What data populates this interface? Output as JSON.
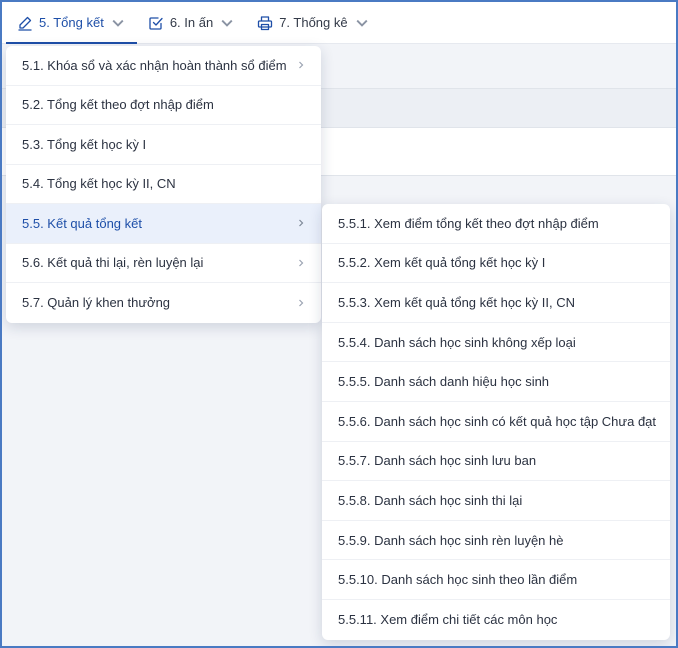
{
  "topnav": {
    "tabs": [
      {
        "label": "5. Tổng kết",
        "icon": "pencil-icon",
        "active": true
      },
      {
        "label": "6. In ấn",
        "icon": "checkbox-icon",
        "active": false
      },
      {
        "label": "7. Thống kê",
        "icon": "printer-icon",
        "active": false
      }
    ]
  },
  "menu": {
    "items": [
      {
        "label": "5.1. Khóa sổ và xác nhận hoàn thành sổ điểm",
        "has_submenu": true
      },
      {
        "label": "5.2. Tổng kết theo đợt nhập điểm",
        "has_submenu": false
      },
      {
        "label": "5.3. Tổng kết học kỳ I",
        "has_submenu": false
      },
      {
        "label": "5.4. Tổng kết học kỳ II, CN",
        "has_submenu": false
      },
      {
        "label": "5.5. Kết quả tổng kết",
        "has_submenu": true,
        "active": true
      },
      {
        "label": "5.6. Kết quả thi lại, rèn luyện lại",
        "has_submenu": true
      },
      {
        "label": "5.7. Quản lý khen thưởng",
        "has_submenu": true
      }
    ]
  },
  "submenu": {
    "items": [
      "5.5.1. Xem điểm tổng kết theo đợt nhập điểm",
      "5.5.2. Xem kết quả tổng kết học kỳ I",
      "5.5.3. Xem kết quả tổng kết học kỳ II, CN",
      "5.5.4. Danh sách học sinh không xếp loại",
      "5.5.5. Danh sách danh hiệu học sinh",
      "5.5.6. Danh sách học sinh có kết quả học tập Chưa đạt",
      "5.5.7. Danh sách học sinh lưu ban",
      "5.5.8. Danh sách học sinh thi lại",
      "5.5.9. Danh sách học sinh rèn luyện hè",
      "5.5.10. Danh sách học sinh theo lần điểm",
      "5.5.11. Xem điểm chi tiết các môn học"
    ]
  },
  "colors": {
    "accent": "#1e4fa8",
    "frame_border": "#4a7ac3",
    "active_bg": "#eaf0fb"
  }
}
